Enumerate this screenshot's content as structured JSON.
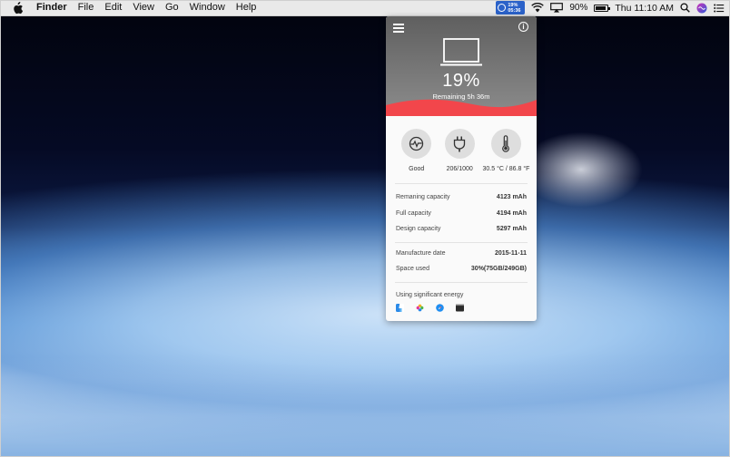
{
  "menubar": {
    "app_name": "Finder",
    "items": [
      "File",
      "Edit",
      "View",
      "Go",
      "Window",
      "Help"
    ],
    "status_app_percent": "19%",
    "status_app_time": "05:36",
    "battery_percent": "90%",
    "battery_level": 0.9,
    "clock": "Thu 11:10 AM",
    "icons": [
      "apple-icon",
      "wifi-icon",
      "airplay-icon",
      "battery-icon",
      "spotlight-icon",
      "siri-icon",
      "notification-center-icon"
    ]
  },
  "panel": {
    "percent": "19%",
    "remaining": "Remaining 5h 36m",
    "battery_level": 0.19,
    "accent_color": "#f2464b",
    "stats": [
      {
        "icon": "health-pulse-icon",
        "label": "Good"
      },
      {
        "icon": "plug-icon",
        "label": "206/1000"
      },
      {
        "icon": "thermometer-icon",
        "label": "30.5 °C / 86.8 °F"
      }
    ],
    "capacity": [
      {
        "label": "Remaning capacity",
        "value": "4123 mAh"
      },
      {
        "label": "Full capacity",
        "value": "4194 mAh"
      },
      {
        "label": "Design capacity",
        "value": "5297 mAh"
      }
    ],
    "info": [
      {
        "label": "Manufacture date",
        "value": "2015-11-11"
      },
      {
        "label": "Space used",
        "value": "30%(75GB/249GB)"
      }
    ],
    "energy_title": "Using significant energy",
    "energy_apps": [
      "finder-app-icon",
      "photos-app-icon",
      "safari-app-icon",
      "terminal-app-icon"
    ]
  }
}
